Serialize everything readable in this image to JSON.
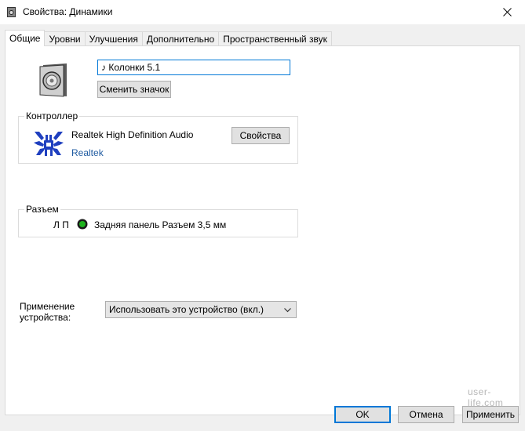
{
  "window": {
    "title": "Свойства: Динамики",
    "title_icon": "speaker-small-icon",
    "close_icon": "close-icon"
  },
  "tabs": [
    {
      "label": "Общие",
      "active": true
    },
    {
      "label": "Уровни",
      "active": false
    },
    {
      "label": "Улучшения",
      "active": false
    },
    {
      "label": "Дополнительно",
      "active": false
    },
    {
      "label": "Пространственный звук",
      "active": false
    }
  ],
  "general": {
    "device_icon": "speaker-icon",
    "device_name_value": "♪ Колонки 5.1",
    "change_icon_label": "Сменить значок"
  },
  "controller": {
    "group_label": "Контроллер",
    "logo_icon": "realtek-crab-icon",
    "name": "Realtek High Definition Audio",
    "vendor": "Realtek",
    "properties_label": "Свойства"
  },
  "jack": {
    "group_label": "Разъем",
    "channel_label": "Л П",
    "indicator_color": "#1db31d",
    "description": "Задняя панель Разъем 3,5 мм"
  },
  "usage": {
    "label_line1": "Применение",
    "label_line2": "устройства:",
    "selected": "Использовать это устройство (вкл.)"
  },
  "buttons": {
    "ok": "OK",
    "cancel": "Отмена",
    "apply": "Применить"
  },
  "watermark": "user-life.com"
}
